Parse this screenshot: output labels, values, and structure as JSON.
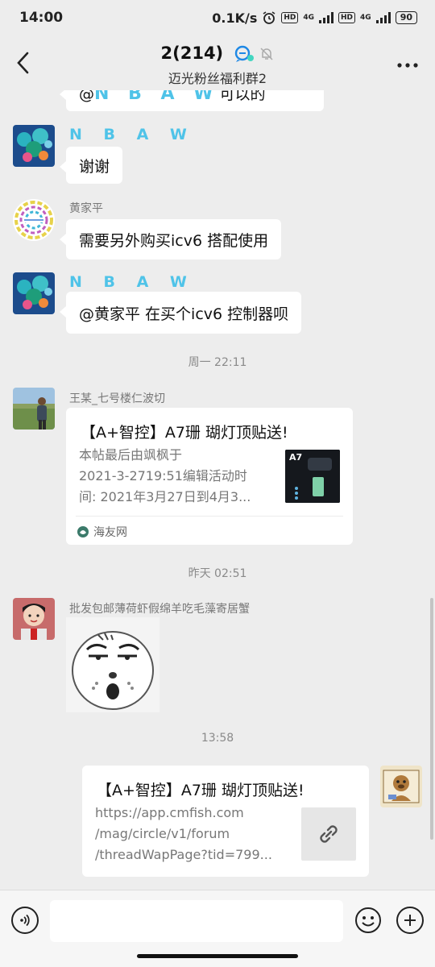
{
  "status_bar": {
    "time": "14:00",
    "network_speed": "0.1K/s",
    "badge_hd": "HD",
    "badge_4g": "4G",
    "battery": "90"
  },
  "header": {
    "title": "2(214)",
    "subtitle": "迈光粉丝福利群2",
    "back_icon": "chevron-left-icon",
    "more_icon": "more-horizontal-icon"
  },
  "messages": {
    "m0": {
      "text_prefix": "@",
      "text_name": "N B A W",
      "text_suffix": "可以的"
    },
    "m1": {
      "sender": "N B A W",
      "text": "谢谢"
    },
    "m2": {
      "sender": "黄家平",
      "text": "需要另外购买icv6 搭配使用"
    },
    "m3": {
      "sender": "N B A W",
      "text": "@黄家平  在买个icv6 控制器呗"
    },
    "ts1": "周一 22:11",
    "m4": {
      "sender": "王某_七号楼仁波切",
      "card_title": "【A+智控】A7珊 瑚灯顶贴送!",
      "desc_line1": "本帖最后由飒枫于",
      "desc_line2": "2021-3-2719:51编辑活动时",
      "desc_line3": "间: 2021年3月27日到4月3...",
      "source": "海友网",
      "thumb_label": "A7"
    },
    "ts2": "昨天 02:51",
    "m5": {
      "sender": "批发包邮薄荷虾假绵羊吃毛藻寄居蟹"
    },
    "ts3": "13:58",
    "m6": {
      "card_title": "【A+智控】A7珊 瑚灯顶贴送!",
      "url_line1": "https://app.cmfish.com",
      "url_line2": "/mag/circle/v1/forum",
      "url_line3": "/threadWapPage?tid=799..."
    }
  },
  "input_bar": {
    "voice_icon": "voice-icon",
    "input_placeholder": "",
    "emoji_icon": "emoji-icon",
    "plus_icon": "plus-icon"
  },
  "colors": {
    "background": "#ededed",
    "bubble": "#ffffff",
    "nbaw_blue": "#4fc3e8"
  }
}
